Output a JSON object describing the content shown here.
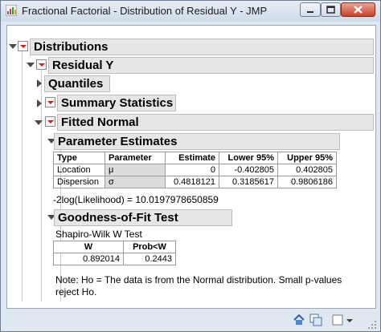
{
  "window": {
    "title": "Fractional Factorial - Distribution of Residual Y - JMP"
  },
  "report": {
    "distributions_title": "Distributions",
    "variable_title": "Residual Y",
    "quantiles_title": "Quantiles",
    "summary_title": "Summary Statistics",
    "fitted_title": "Fitted Normal",
    "param_title": "Parameter Estimates",
    "param_table": {
      "headers": [
        "Type",
        "Parameter",
        "Estimate",
        "Lower 95%",
        "Upper 95%"
      ],
      "rows": [
        [
          "Location",
          "μ",
          "0",
          "-0.402805",
          "0.402805"
        ],
        [
          "Dispersion",
          "σ",
          "0.4818121",
          "0.3185617",
          "0.9806186"
        ]
      ]
    },
    "loglik": "-2log(Likelihood) = 10.0197978650859",
    "gof_title": "Goodness-of-Fit Test",
    "shapiro_label": "Shapiro-Wilk W Test",
    "gof_table": {
      "headers": [
        "W",
        "Prob<W"
      ],
      "values": [
        "0.892014",
        "0.2443"
      ]
    },
    "note": "Note: Ho = The data is from the Normal distribution. Small p-values reject Ho."
  }
}
